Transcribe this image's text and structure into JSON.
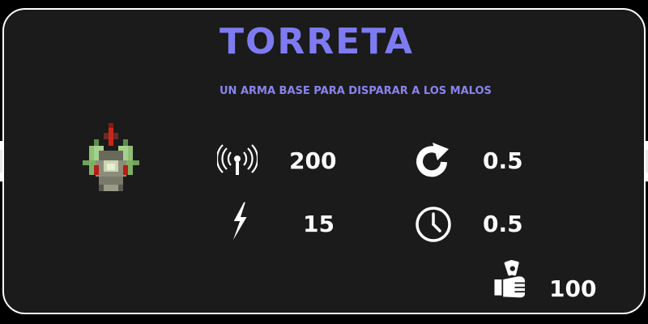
{
  "tower": {
    "name": "TORRETA",
    "description": "UN ARMA BASE PARA DISPARAR A LOS MALOS",
    "sprite_icon": "turret-sprite"
  },
  "stats": {
    "range": {
      "icon": "signal-tower-icon",
      "value": "200"
    },
    "damage": {
      "icon": "lightning-bolt-icon",
      "value": "15"
    },
    "fire_rate": {
      "icon": "reload-arrow-icon",
      "value": "0.5"
    },
    "cooldown": {
      "icon": "clock-icon",
      "value": "0.5"
    },
    "cost": {
      "icon": "hand-money-icon",
      "value": "100"
    }
  },
  "colors": {
    "panel_background": "#1b1b1b",
    "title": "#7e7bf2",
    "text": "#ffffff"
  }
}
